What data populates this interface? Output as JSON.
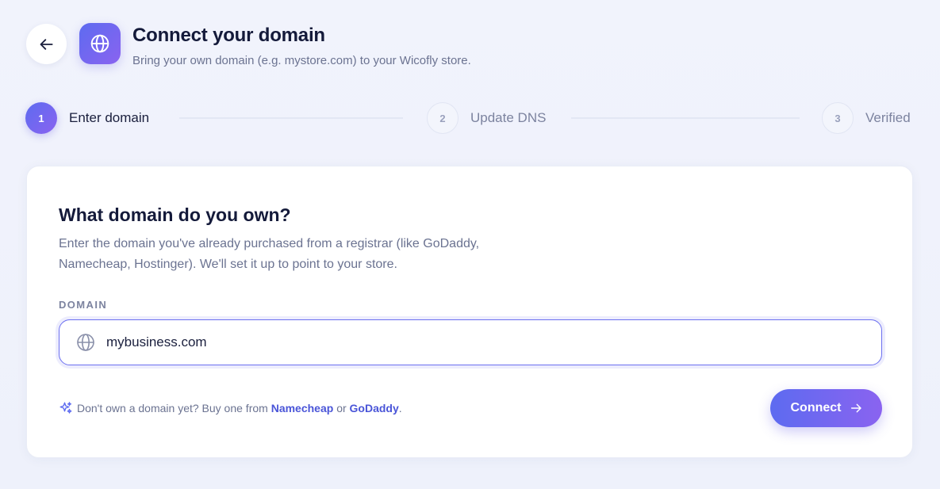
{
  "header": {
    "title": "Connect your domain",
    "subtitle": "Bring your own domain (e.g. mystore.com) to your Wicofly store.",
    "back_icon": "arrow-left-icon",
    "badge_icon": "globe-icon"
  },
  "stepper": {
    "steps": [
      {
        "number": "1",
        "label": "Enter domain",
        "state": "active"
      },
      {
        "number": "2",
        "label": "Update DNS",
        "state": "pending"
      },
      {
        "number": "3",
        "label": "Verified",
        "state": "pending"
      }
    ]
  },
  "card": {
    "heading": "What domain do you own?",
    "description": "Enter the domain you've already purchased from a registrar (like GoDaddy, Namecheap, Hostinger). We'll set it up to point to your store.",
    "field_label": "DOMAIN",
    "input_value": "mybusiness.com",
    "input_icon": "globe-icon",
    "hint": {
      "icon": "sparkle-icon",
      "prefix": "Don't own a domain yet? Buy one from",
      "link1": "Namecheap",
      "middle": "or",
      "link2": "GoDaddy",
      "suffix": "."
    },
    "connect_label": "Connect",
    "connect_icon": "arrow-right-icon"
  },
  "colors": {
    "accent_start": "#5d6bf0",
    "accent_end": "#8a63f0",
    "link": "#4a55d8",
    "background": "#eef1fb"
  }
}
